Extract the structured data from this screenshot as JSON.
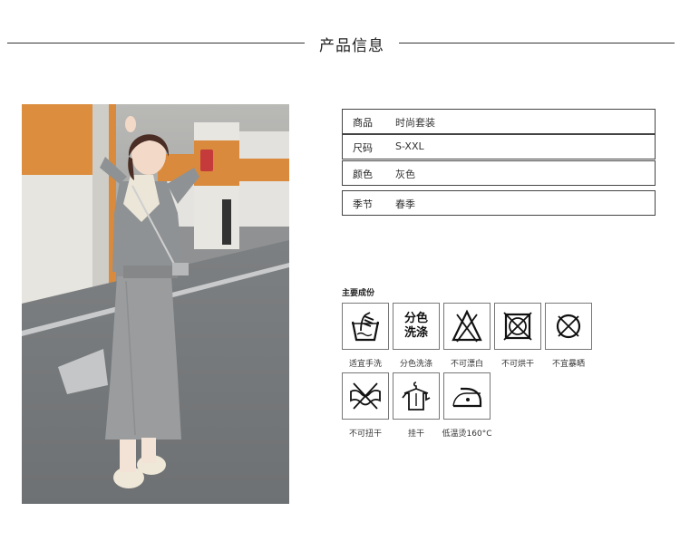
{
  "header": {
    "title": "产品信息"
  },
  "product_info": [
    {
      "label": "商品",
      "value": "时尚套装"
    },
    {
      "label": "尺码",
      "value": "S-XXL"
    },
    {
      "label": "颜色",
      "value": "灰色"
    },
    {
      "label": "季节",
      "value": "春季"
    }
  ],
  "care": {
    "title": "主要成份",
    "items": [
      {
        "icon": "hand-wash-icon",
        "label": "适宜手洗"
      },
      {
        "icon": "separate-wash-icon",
        "label": "分色洗涤",
        "icon_text": [
          "分色",
          "洗涤"
        ]
      },
      {
        "icon": "no-bleach-icon",
        "label": "不可漂白"
      },
      {
        "icon": "no-tumble-dry-icon",
        "label": "不可烘干"
      },
      {
        "icon": "no-sun-dry-icon",
        "label": "不宜暴晒"
      },
      {
        "icon": "no-wring-icon",
        "label": "不可扭干"
      },
      {
        "icon": "hang-dry-icon",
        "label": "挂干"
      },
      {
        "icon": "low-iron-icon",
        "label": "低温烫160°C"
      }
    ]
  },
  "colors": {
    "line": "#333333",
    "border": "#444444",
    "orange_wall": "#d98a3c",
    "garment_gray": "#9a9c9e"
  }
}
